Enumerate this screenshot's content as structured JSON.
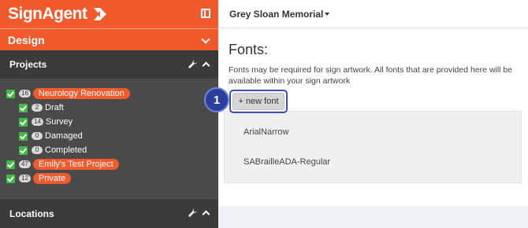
{
  "brand": {
    "name": "SignAgent"
  },
  "sidebar": {
    "design_label": "Design",
    "projects_label": "Projects",
    "locations_label": "Locations",
    "tree": [
      {
        "count": "16",
        "label": "Neurology Renovation",
        "pill": true,
        "child": false
      },
      {
        "count": "2",
        "label": "Draft",
        "pill": false,
        "child": true
      },
      {
        "count": "14",
        "label": "Survey",
        "pill": false,
        "child": true
      },
      {
        "count": "0",
        "label": "Damaged",
        "pill": false,
        "child": true
      },
      {
        "count": "0",
        "label": "Completed",
        "pill": false,
        "child": true
      },
      {
        "count": "47",
        "label": "Emily's Test Project",
        "pill": true,
        "child": false
      },
      {
        "count": "12",
        "label": "Private",
        "pill": true,
        "child": false
      }
    ]
  },
  "topbar": {
    "organization": "Grey Sloan Memorial"
  },
  "main": {
    "title": "Fonts:",
    "description": "Fonts may be required for sign artwork. All fonts that are provided here will be available within your sign artwork",
    "new_font_label": "+ new font",
    "step_number": "1",
    "fonts": [
      "ArialNarrow",
      "SABrailleADA-Regular"
    ]
  },
  "colors": {
    "brand_orange": "#f05a2d",
    "sidebar_dark": "#4a4a4a",
    "check_green": "#3dbb43",
    "step_blue": "#2c3f9e"
  },
  "icons": [
    "signagent-logo-icon",
    "collapse-sidebar-icon",
    "chevron-down-icon",
    "wrench-icon",
    "chevron-up-icon",
    "checkbox-checked-icon",
    "caret-down-icon"
  ]
}
